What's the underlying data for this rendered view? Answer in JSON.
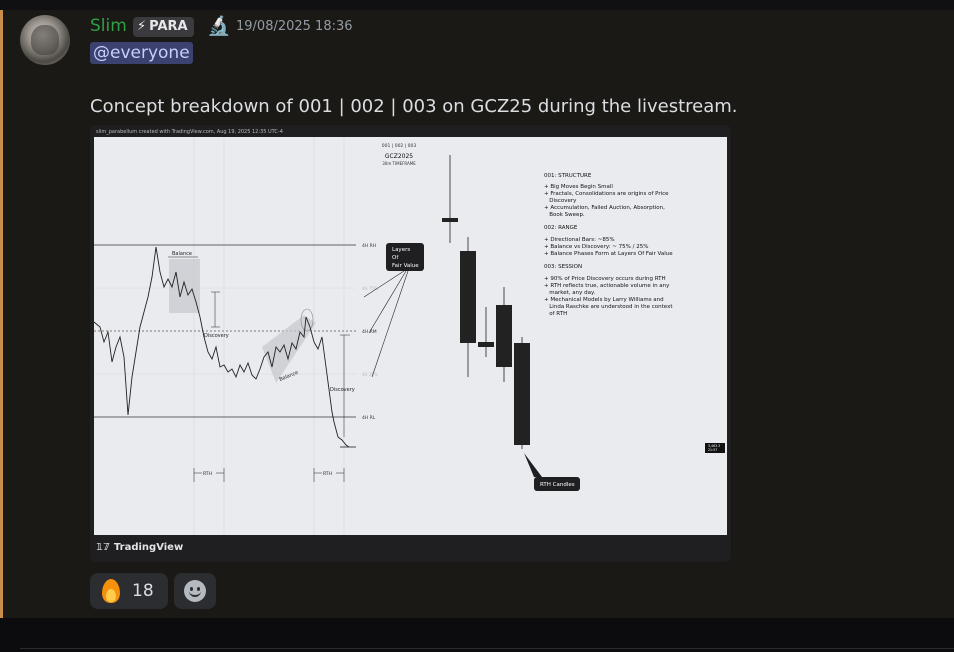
{
  "message": {
    "author": "Slim",
    "badge": "PARA",
    "timestamp": "19/08/2025 18:36",
    "mention": "@everyone",
    "content": "Concept breakdown of 001 | 002 | 003 on GCZ25 during the livestream."
  },
  "embed": {
    "credit": "slim_parabellum created with TradingView.com, Aug 19, 2025 12:35 UTC-4",
    "brand": "TradingView",
    "chart": {
      "header": "001 | 002 | 003",
      "title": "GCZ2025",
      "subtitle": "30m TIMEFRAME",
      "levels": {
        "four_h_rh": "4H RH",
        "four_h_eq": "4H RM",
        "four_h_rl": "4H RL",
        "faint_upper": "4H 75%",
        "faint_lower": "4H 25%"
      },
      "annotations": {
        "balance_1": "Balance",
        "discovery_1": "Discovery",
        "balance_2": "Balance",
        "discovery_2": "Discovery",
        "rth_1": "RTH",
        "rth_2": "RTH",
        "layers": [
          "Layers",
          "Of",
          "Fair Value"
        ],
        "rth_candles": "RTH Candles",
        "price_tag": [
          "3,463.3",
          "21:57"
        ]
      },
      "notes": {
        "structure_title": "001: STRUCTURE",
        "structure_items": [
          "+ Big Moves Begin Small",
          "+ Fractals, Consolidations are origins of Price",
          "   Discovery",
          "+ Accumulation, Failed Auction, Absorption,",
          "   Book Sweep."
        ],
        "range_title": "002: RANGE",
        "range_items": [
          "+ Directional Bars: ~85%",
          "+ Balance vs Discovery: ~ 75% / 25%",
          "+ Balance Phases Form at Layers Of Fair Value"
        ],
        "session_title": "003: SESSION",
        "session_items": [
          "+ 90% of Price Discovery occurs during RTH",
          "+ RTH reflects true, actionable volume in any",
          "   market, any day.",
          "+ Mechanical Models by Larry Williams and",
          "   Linda Raschke are understood in the context",
          "   of RTH"
        ]
      }
    }
  },
  "reactions": [
    {
      "emoji": "fire-icon",
      "count": "18"
    }
  ],
  "colors": {
    "author": "#2ea043",
    "mention_bg": "#3c4270",
    "accent_bar": "#c98f4a",
    "chart_bg": "#e9ebef"
  }
}
